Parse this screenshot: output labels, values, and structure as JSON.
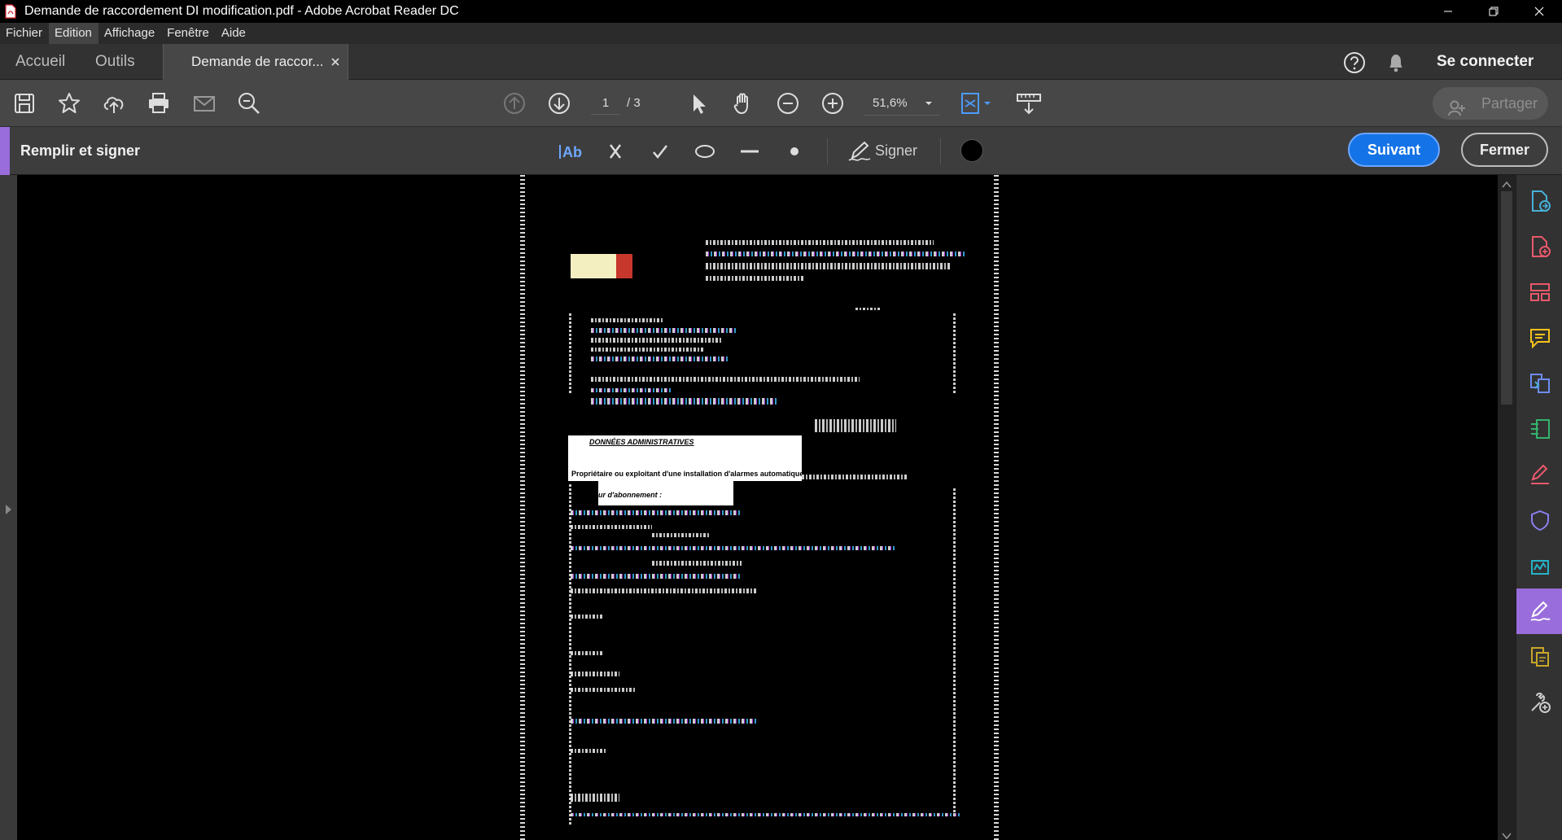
{
  "window": {
    "title": "Demande de raccordement DI modification.pdf - Adobe Acrobat Reader DC"
  },
  "menu": [
    "Fichier",
    "Edition",
    "Affichage",
    "Fenêtre",
    "Aide"
  ],
  "tabs": {
    "home": "Accueil",
    "tools": "Outils",
    "document": "Demande de raccor...",
    "sign_in": "Se connecter"
  },
  "toolbar": {
    "page_current": "1",
    "page_total": "/ 3",
    "zoom": "51,6%",
    "share": "Partager"
  },
  "fill_sign": {
    "title": "Remplir et signer",
    "sign": "Signer",
    "next": "Suivant",
    "close": "Fermer",
    "color": "#000000"
  },
  "document": {
    "section_heading": "DONNÉES  ADMINISTRATIVES",
    "line_owner": "Propriétaire ou exploitant d'une installation d'alarmes automatiques",
    "line_subscription": "ur d'abonnement :"
  },
  "right_panel": {
    "icons": [
      "export-pdf-icon",
      "create-pdf-icon",
      "organize-pages-icon",
      "comment-icon",
      "combine-files-icon",
      "edit-pdf-icon",
      "fill-sign-icon",
      "protect-icon",
      "send-for-signature-icon",
      "fill-sign-active-icon",
      "scan-icon",
      "more-tools-icon"
    ],
    "colors": {
      "accent_purple": "#9a6ddc",
      "blue": "#1473e6"
    }
  }
}
